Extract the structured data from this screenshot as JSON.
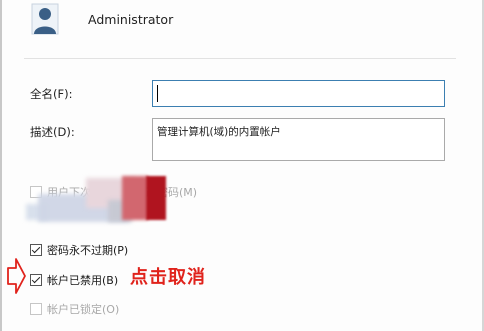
{
  "user": {
    "name": "Administrator"
  },
  "form": {
    "fullname_label": "全名(F):",
    "fullname_value": "",
    "description_label": "描述(D):",
    "description_value": "管理计算机(域)的内置帐户"
  },
  "options": {
    "change_password": {
      "label": "用户下次登录时须更改密码(M)",
      "checked": false,
      "enabled": false
    },
    "never_expires": {
      "label": "密码永不过期(P)",
      "checked": true,
      "enabled": true
    },
    "account_disabled": {
      "label": "帐户已禁用(B)",
      "checked": true,
      "enabled": true
    },
    "account_locked": {
      "label": "帐户已锁定(O)",
      "checked": false,
      "enabled": false
    }
  },
  "annotation": {
    "text": "点击取消",
    "color": "#e0231c"
  },
  "icons": {
    "user": "user-avatar-icon",
    "arrow": "right-arrow-icon"
  }
}
